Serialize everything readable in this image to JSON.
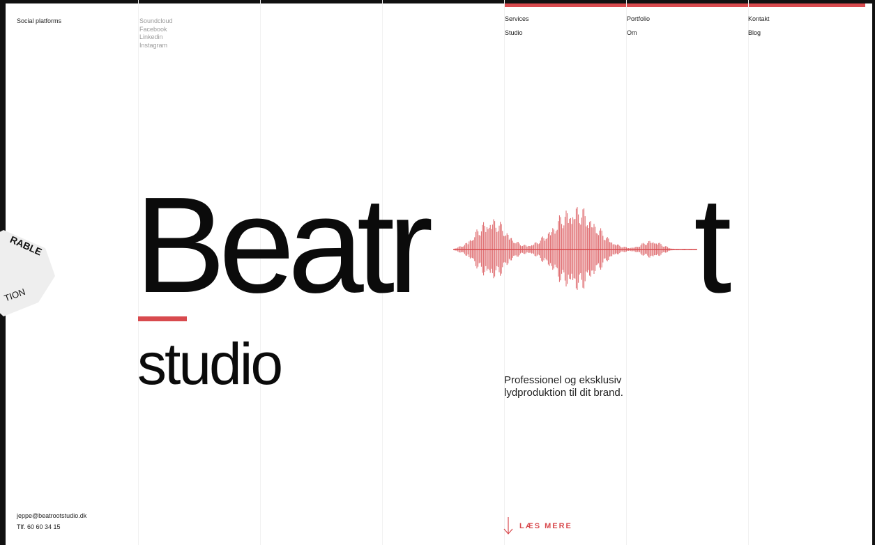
{
  "social": {
    "title": "Social platforms",
    "links": [
      "Soundcloud",
      "Facebook",
      "Linkedin",
      "Instagram"
    ]
  },
  "nav": [
    {
      "label": "Services"
    },
    {
      "label": "Portfolio"
    },
    {
      "label": "Kontakt"
    },
    {
      "label": "Studio"
    },
    {
      "label": "Om"
    },
    {
      "label": "Blog"
    }
  ],
  "hero": {
    "word_start": "Beatr",
    "word_end": "t",
    "subtitle": "studio"
  },
  "badge": {
    "line1": "RABLE",
    "line2": "TION"
  },
  "tagline": {
    "line1": "Professionel og eksklusiv",
    "line2": "lydproduktion til dit brand."
  },
  "contact": {
    "email": "jeppe@beatrootstudio.dk",
    "phone": "Tlf. 60 60 34 15"
  },
  "read_more": {
    "label": "LÆS MERE",
    "icon": "arrow-down-icon"
  },
  "colors": {
    "accent": "#d84a4e",
    "text": "#0b0b0b",
    "muted": "#9a9a9a"
  }
}
